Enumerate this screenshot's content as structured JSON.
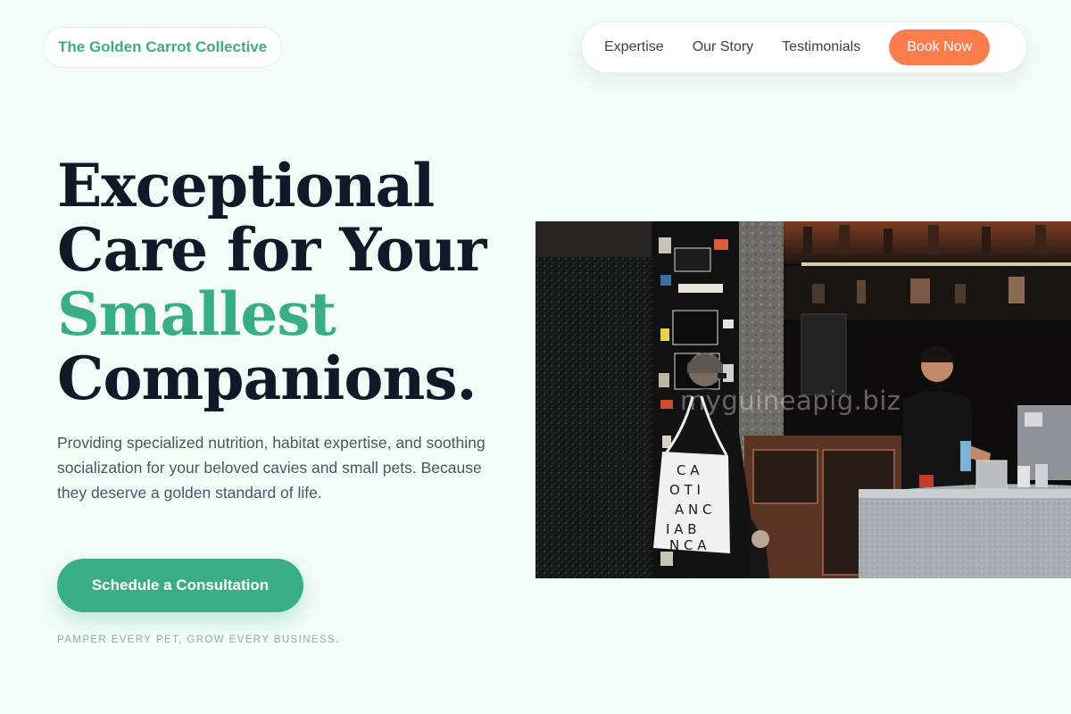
{
  "brand": {
    "name": "The Golden Carrot Collective"
  },
  "nav": {
    "items": [
      {
        "label": "Expertise"
      },
      {
        "label": "Our Story"
      },
      {
        "label": "Testimonials"
      }
    ],
    "cta_label": "Book Now"
  },
  "hero": {
    "title_line1": "Exceptional",
    "title_line2": "Care for Your",
    "title_accent": "Smallest",
    "title_line4": "Companions.",
    "description": "Providing specialized nutrition, habitat expertise, and soothing socialization for your beloved cavies and small pets. Because they deserve a golden standard of life.",
    "cta_label": "Schedule a Consultation",
    "tagline": "PAMPER EVERY PET, GROW EVERY BUSINESS."
  },
  "photo": {
    "watermark": "myguineapig.biz",
    "tote_letters": "C A  O T I  A N C  I A B  N C A"
  },
  "colors": {
    "background": "#f3fdf8",
    "brand_green": "#3aae83",
    "accent_orange": "#fb7d4d",
    "heading": "#111827"
  }
}
